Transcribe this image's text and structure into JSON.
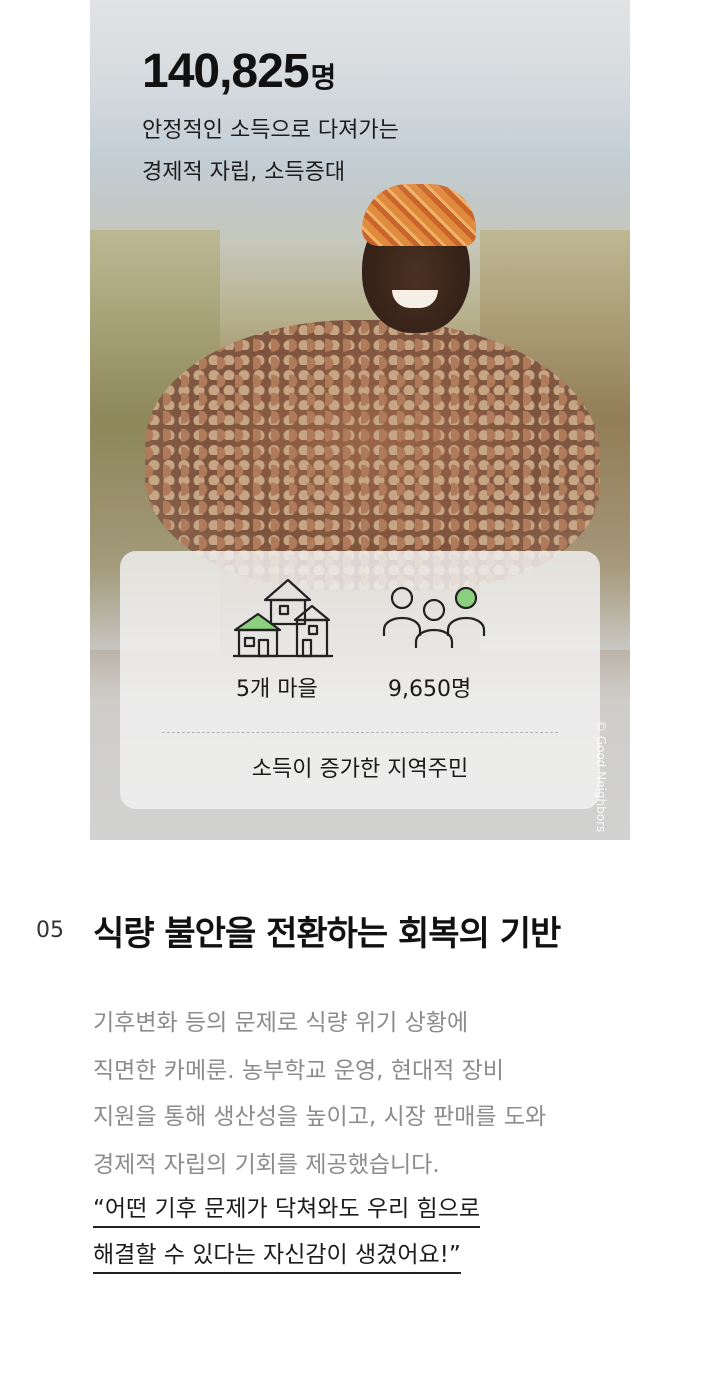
{
  "hero": {
    "number": "140,825",
    "unit": "명",
    "line1": "안정적인 소득으로 다져가는",
    "line2": "경제적 자립, 소득증대"
  },
  "stats": {
    "villages": "5개 마을",
    "residents": "9,650명",
    "caption": "소득이 증가한 지역주민"
  },
  "credit": "© Good Neighbors",
  "section": {
    "number": "05",
    "title": "식량 불안을 전환하는 회복의 기반",
    "paragraph": [
      "기후변화 등의 문제로 식량 위기 상황에",
      "직면한 카메룬. 농부학교 운영, 현대적 장비",
      "지원을 통해 생산성을 높이고, 시장 판매를 도와",
      "경제적 자립의 기회를 제공했습니다."
    ],
    "quote": [
      "“어떤 기후 문제가 닥쳐와도 우리 힘으로",
      "해결할 수 있다는 자신감이 생겼어요!”"
    ]
  },
  "colors": {
    "accent_green": "#8ccf7e",
    "icon_stroke": "#222222"
  },
  "icons": [
    "houses-icon",
    "people-icon"
  ]
}
